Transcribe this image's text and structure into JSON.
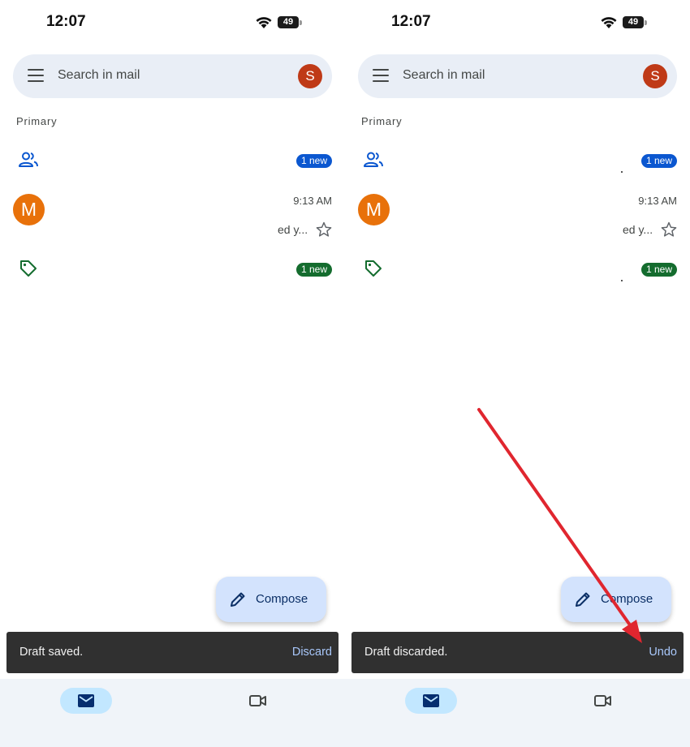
{
  "colors": {
    "search_bg": "#e9eef6",
    "account_avatar": "#bf3a17",
    "sender_avatar": "#e8710a",
    "badge_blue": "#0b57d0",
    "badge_green": "#146c2e",
    "compose_bg": "#d3e3fd",
    "snackbar_bg": "#303030",
    "snackbar_action": "#a8c7fa",
    "nav_active": "#c2e7ff",
    "annotation_arrow": "#e0262f"
  },
  "screens": [
    {
      "status": {
        "time": "12:07",
        "battery": "49"
      },
      "search": {
        "placeholder": "Search in mail",
        "avatar_letter": "S"
      },
      "section_label": "Primary",
      "social_row": {
        "icon": "people-icon",
        "badge": "1 new"
      },
      "mail_row": {
        "avatar_letter": "M",
        "time": "9:13 AM",
        "snippet": "ed y...",
        "icon": "star-outline-icon"
      },
      "promo_row": {
        "icon": "tag-icon",
        "badge": "1 new"
      },
      "compose": {
        "label": "Compose",
        "icon": "pencil-icon"
      },
      "snackbar": {
        "message": "Draft saved.",
        "action": "Discard"
      },
      "bottom_nav": [
        {
          "icon": "mail-icon",
          "active": true
        },
        {
          "icon": "video-camera-icon",
          "active": false
        }
      ]
    },
    {
      "status": {
        "time": "12:07",
        "battery": "49"
      },
      "search": {
        "placeholder": "Search in mail",
        "avatar_letter": "S"
      },
      "section_label": "Primary",
      "social_row": {
        "icon": "people-icon",
        "badge": "1 new"
      },
      "mail_row": {
        "avatar_letter": "M",
        "time": "9:13 AM",
        "snippet": "ed y...",
        "icon": "star-outline-icon"
      },
      "promo_row": {
        "icon": "tag-icon",
        "badge": "1 new"
      },
      "compose": {
        "label": "Compose",
        "icon": "pencil-icon"
      },
      "snackbar": {
        "message": "Draft discarded.",
        "action": "Undo"
      },
      "bottom_nav": [
        {
          "icon": "mail-icon",
          "active": true
        },
        {
          "icon": "video-camera-icon",
          "active": false
        }
      ]
    }
  ]
}
